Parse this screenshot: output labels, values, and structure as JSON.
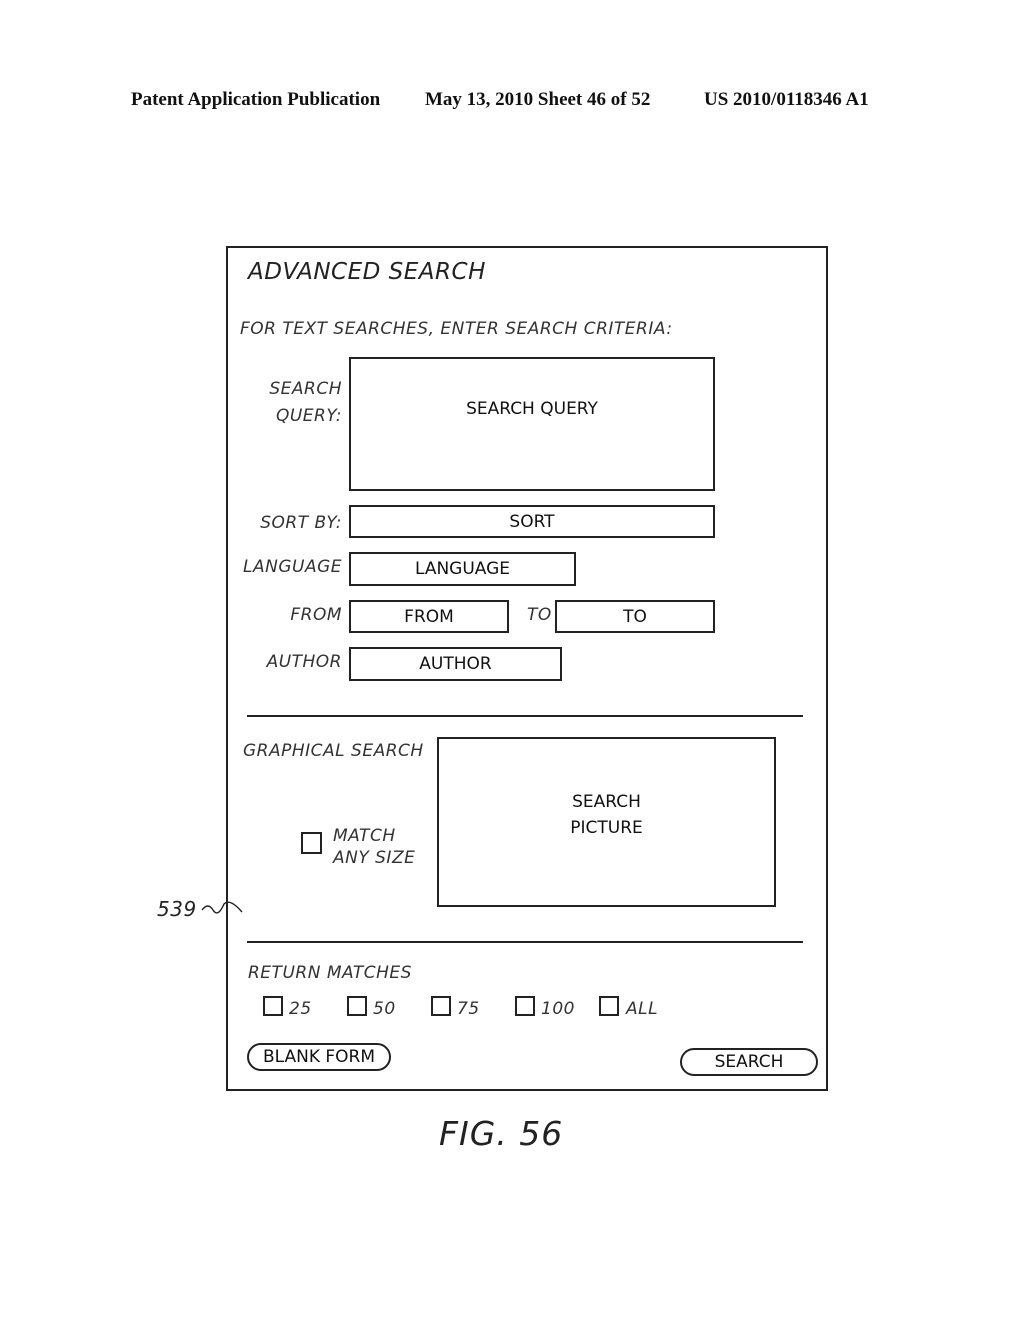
{
  "header": {
    "publication": "Patent Application Publication",
    "date_sheet": "May 13, 2010  Sheet 46 of 52",
    "pub_number": "US 2010/0118346 A1"
  },
  "form": {
    "title": "ADVANCED SEARCH",
    "instruction": "FOR TEXT SEARCHES, ENTER SEARCH CRITERIA:",
    "search_query": {
      "label_line1": "SEARCH",
      "label_line2": "QUERY:",
      "value": "SEARCH QUERY"
    },
    "sort": {
      "label": "SORT BY:",
      "value": "SORT"
    },
    "language": {
      "label": "LANGUAGE",
      "value": "LANGUAGE"
    },
    "from": {
      "label": "FROM",
      "value": "FROM"
    },
    "to": {
      "label": "TO",
      "value": "TO"
    },
    "author": {
      "label": "AUTHOR",
      "value": "AUTHOR"
    },
    "graphical_search": {
      "label": "GRAPHICAL SEARCH",
      "picture_line1": "SEARCH",
      "picture_line2": "PICTURE",
      "match_any_size_line1": "MATCH",
      "match_any_size_line2": "ANY SIZE",
      "match_any_size_checked": false
    },
    "return_matches": {
      "label": "RETURN MATCHES",
      "options": [
        {
          "label": "25",
          "checked": false
        },
        {
          "label": "50",
          "checked": false
        },
        {
          "label": "75",
          "checked": false
        },
        {
          "label": "100",
          "checked": false
        },
        {
          "label": "ALL",
          "checked": false
        }
      ]
    },
    "buttons": {
      "blank_form": "BLANK FORM",
      "search": "SEARCH"
    }
  },
  "reference_numeral": "539",
  "figure_caption": "FIG. 56"
}
